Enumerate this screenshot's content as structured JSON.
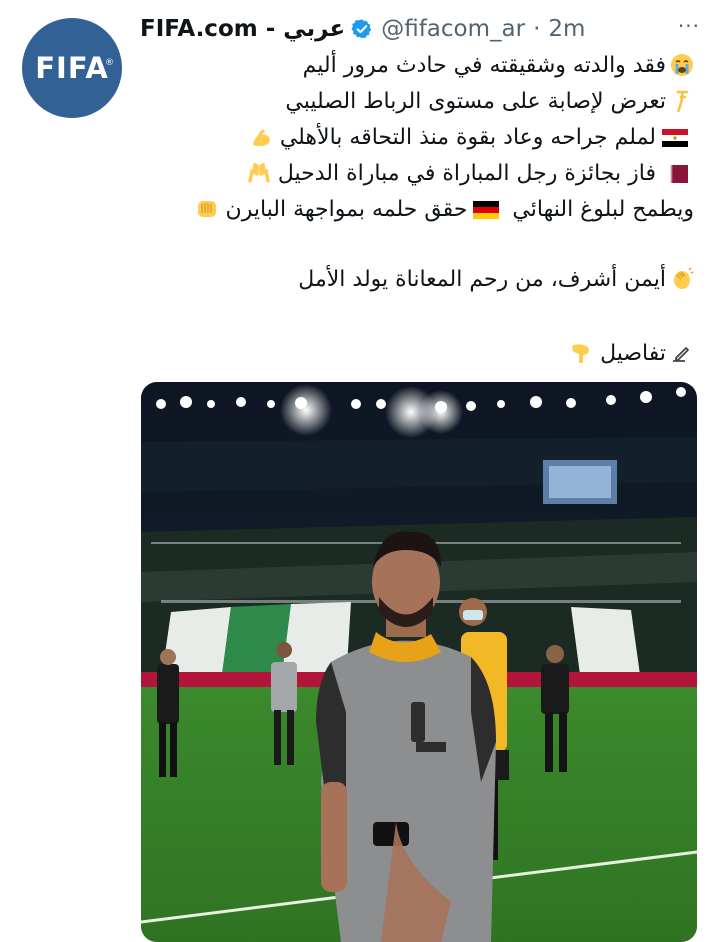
{
  "tweet": {
    "avatar_text": "FIFA",
    "avatar_mark": "®",
    "display_name": "FIFA.com - عربي",
    "handle": "@fifacom_ar",
    "separator": "·",
    "time": "2m",
    "more": "···",
    "lines": [
      "فقد والدته وشقيقته في حادث مرور أليم",
      "تعرض لإصابة على مستوى الرباط الصليبي",
      "لملم جراحه وعاد بقوة منذ التحاقه بالأهلي",
      "فاز بجائزة رجل المباراة في مباراة الدحيل",
      "حقق حلمه بمواجهة البايرن",
      "ويطمح لبلوغ النهائي",
      "أيمن أشرف، من رحم المعاناة يولد الأمل",
      "تفاصيل"
    ],
    "icons": {
      "line1": "crying-face-icon",
      "line2": "crutch-icon",
      "line3": "flexed-biceps-icon",
      "line4": "raising-hands-icon",
      "line5": "folded-hands-icon",
      "line6": "clapping-hands-icon",
      "line7": "writing-hand-icon"
    },
    "colors": {
      "avatar_bg": "#326295",
      "verified": "#1d9bf0",
      "muted": "#536471"
    }
  }
}
